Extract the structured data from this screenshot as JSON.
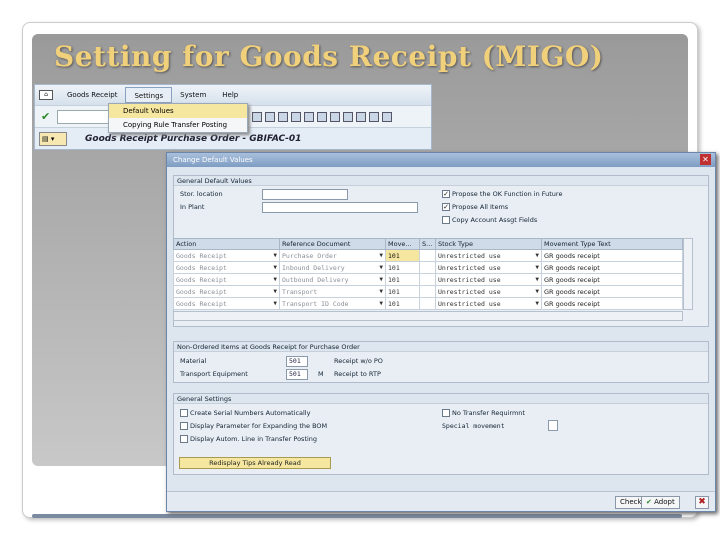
{
  "slide": {
    "title": "Setting for Goods Receipt (MIGO)"
  },
  "sap": {
    "menu": [
      "Goods Receipt",
      "Settings",
      "System",
      "Help"
    ],
    "settings_menu": [
      "Default Values",
      "Copying Rule Transfer Posting"
    ],
    "title": "Goods Receipt Purchase Order - GBIFAC-01"
  },
  "dialog": {
    "title": "Change Default Values",
    "general_defaults": {
      "header": "General Default Values",
      "stor_location_label": "Stor. location",
      "in_plant_label": "In Plant",
      "propose_ok_label": "Propose the OK Function in Future",
      "propose_ok_checked": true,
      "propose_all_label": "Propose All Items",
      "propose_all_checked": true,
      "copy_account_label": "Copy Account Assgt Fields",
      "copy_account_checked": false
    },
    "table": {
      "columns": [
        "Action",
        "Reference Document",
        "Move...",
        "S...",
        "Stock Type",
        "Movement Type Text"
      ],
      "rows": [
        [
          "Goods Receipt",
          "Purchase Order",
          "101",
          "",
          "Unrestricted use",
          "GR goods receipt"
        ],
        [
          "Goods Receipt",
          "Inbound Delivery",
          "101",
          "",
          "Unrestricted use",
          "GR goods receipt"
        ],
        [
          "Goods Receipt",
          "Outbound Delivery",
          "101",
          "",
          "Unrestricted use",
          "GR goods receipt"
        ],
        [
          "Goods Receipt",
          "Transport",
          "101",
          "",
          "Unrestricted use",
          "GR goods receipt"
        ],
        [
          "Goods Receipt",
          "Transport ID Code",
          "101",
          "",
          "Unrestricted use",
          "GR goods receipt"
        ]
      ]
    },
    "non_ordered": {
      "header": "Non-Ordered Items at Goods Receipt for Purchase Order",
      "material_label": "Material",
      "material_value": "501",
      "material_desc": "Receipt w/o PO",
      "transport_label": "Transport Equipment",
      "transport_value": "501",
      "transport_flag": "M",
      "transport_desc": "Receipt to RTP"
    },
    "general_settings": {
      "header": "General Settings",
      "serial_label": "Create Serial Numbers Automatically",
      "display_bom_label": "Display Parameter for Expanding the BOM",
      "display_autom_label": "Display Autom. Line in Transfer Posting",
      "no_transfer_label": "No Transfer Requirmnt",
      "special_label": "Special movement",
      "redisplay_label": "Redisplay Tips Already Read"
    },
    "buttons": {
      "check": "Check",
      "adopt": "Adopt"
    }
  }
}
